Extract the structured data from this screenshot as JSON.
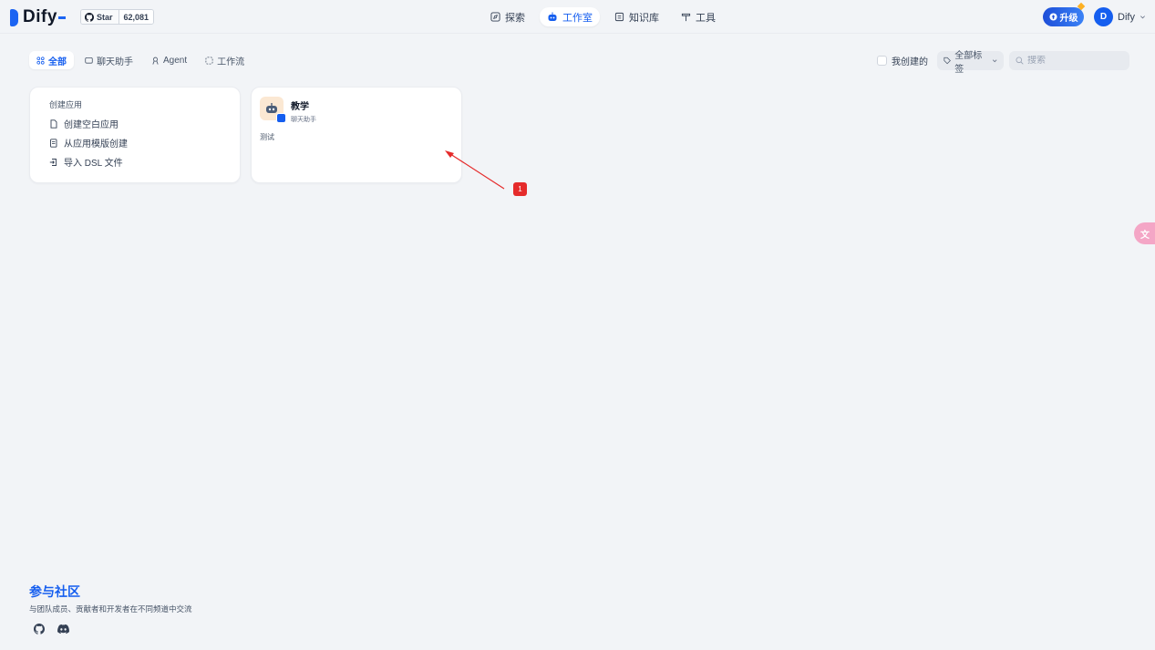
{
  "brand": {
    "name": "Dify"
  },
  "github": {
    "star_label": "Star",
    "count": "62,081"
  },
  "nav": [
    {
      "label": "探索",
      "icon": "compass-icon"
    },
    {
      "label": "工作室",
      "icon": "robot-icon",
      "active": true
    },
    {
      "label": "知识库",
      "icon": "book-icon"
    },
    {
      "label": "工具",
      "icon": "hammer-icon"
    }
  ],
  "header": {
    "upgrade_label": "升级",
    "user_initial": "D",
    "user_name": "Dify"
  },
  "filters": {
    "tabs": [
      {
        "label": "全部",
        "active": true
      },
      {
        "label": "聊天助手"
      },
      {
        "label": "Agent"
      },
      {
        "label": "工作流"
      }
    ],
    "created_by_me": "我创建的",
    "tags_label": "全部标签",
    "search_placeholder": "搜索"
  },
  "create_card": {
    "title": "创建应用",
    "items": [
      "创建空白应用",
      "从应用模版创建",
      "导入 DSL 文件"
    ]
  },
  "apps": [
    {
      "name": "教学",
      "type": "聊天助手",
      "description": "测试"
    }
  ],
  "annotation": {
    "label": "1"
  },
  "translate_label": "文",
  "footer": {
    "title": "参与社区",
    "description": "与团队成员、贡献者和开发者在不同频道中交流"
  },
  "colors": {
    "accent": "#155eef",
    "background": "#f2f4f7",
    "annotation": "#e52b2b"
  }
}
